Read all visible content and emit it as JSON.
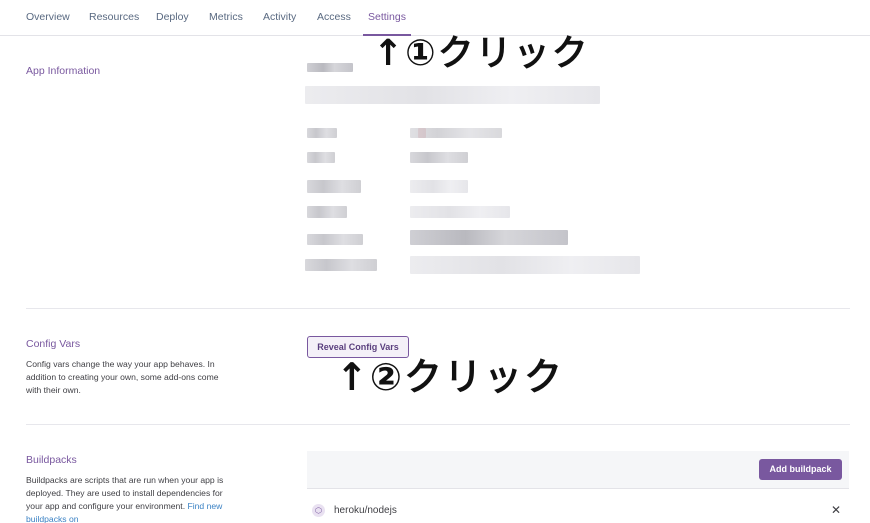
{
  "nav": {
    "tabs": [
      {
        "label": "Overview"
      },
      {
        "label": "Resources"
      },
      {
        "label": "Deploy"
      },
      {
        "label": "Metrics"
      },
      {
        "label": "Activity"
      },
      {
        "label": "Access"
      },
      {
        "label": "Settings"
      }
    ],
    "active_tab": "Settings"
  },
  "annotations": {
    "step1": "↑①クリック",
    "step2": "↑②クリック"
  },
  "app_information": {
    "title": "App Information"
  },
  "config_vars": {
    "title": "Config Vars",
    "description": "Config vars change the way your app behaves. In addition to creating your own, some add-ons come with their own.",
    "reveal_button": "Reveal Config Vars"
  },
  "buildpacks": {
    "title": "Buildpacks",
    "description": "Buildpacks are scripts that are run when your app is deployed. They are used to install dependencies for your app and configure your environment.",
    "link_text": "Find new buildpacks on",
    "add_button": "Add buildpack",
    "items": [
      {
        "name": "heroku/nodejs",
        "icon": "hexagon-icon",
        "remove_icon": "close-icon"
      }
    ]
  },
  "colors": {
    "accent": "#79589f",
    "link": "#3b82c4"
  }
}
